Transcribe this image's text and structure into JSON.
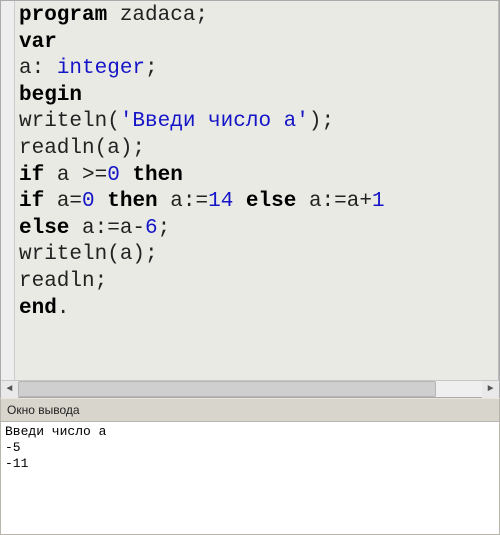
{
  "code": {
    "l1": {
      "kw": "program",
      "rest": " zadaca;"
    },
    "l2": {
      "kw": "var"
    },
    "l3": {
      "a": "a: ",
      "type": "integer",
      "b": ";"
    },
    "l4": {
      "kw": "begin"
    },
    "l5": {
      "a": "writeln(",
      "str": "'Введи число а'",
      "b": ");"
    },
    "l6": {
      "a": "readln(a);"
    },
    "l7": {
      "kw1": "if",
      "a": " a >=",
      "num": "0",
      "b": " ",
      "kw2": "then"
    },
    "l8": {
      "kw1": "if",
      "a": " a=",
      "n1": "0",
      "b": " ",
      "kw2": "then",
      "c": " a:=",
      "n2": "14",
      "d": " ",
      "kw3": "else",
      "e": " a:=a+",
      "n3": "1"
    },
    "l9": {
      "kw": "else",
      "a": " a:=a-",
      "num": "6",
      "b": ";"
    },
    "l10": {
      "a": "writeln(a);"
    },
    "l11": {
      "a": "readln;"
    },
    "l12": {
      "kw": "end",
      "a": "."
    }
  },
  "output": {
    "title": "Окно вывода",
    "line1": "Введи число а",
    "line2": "-5",
    "line3": "-11"
  }
}
